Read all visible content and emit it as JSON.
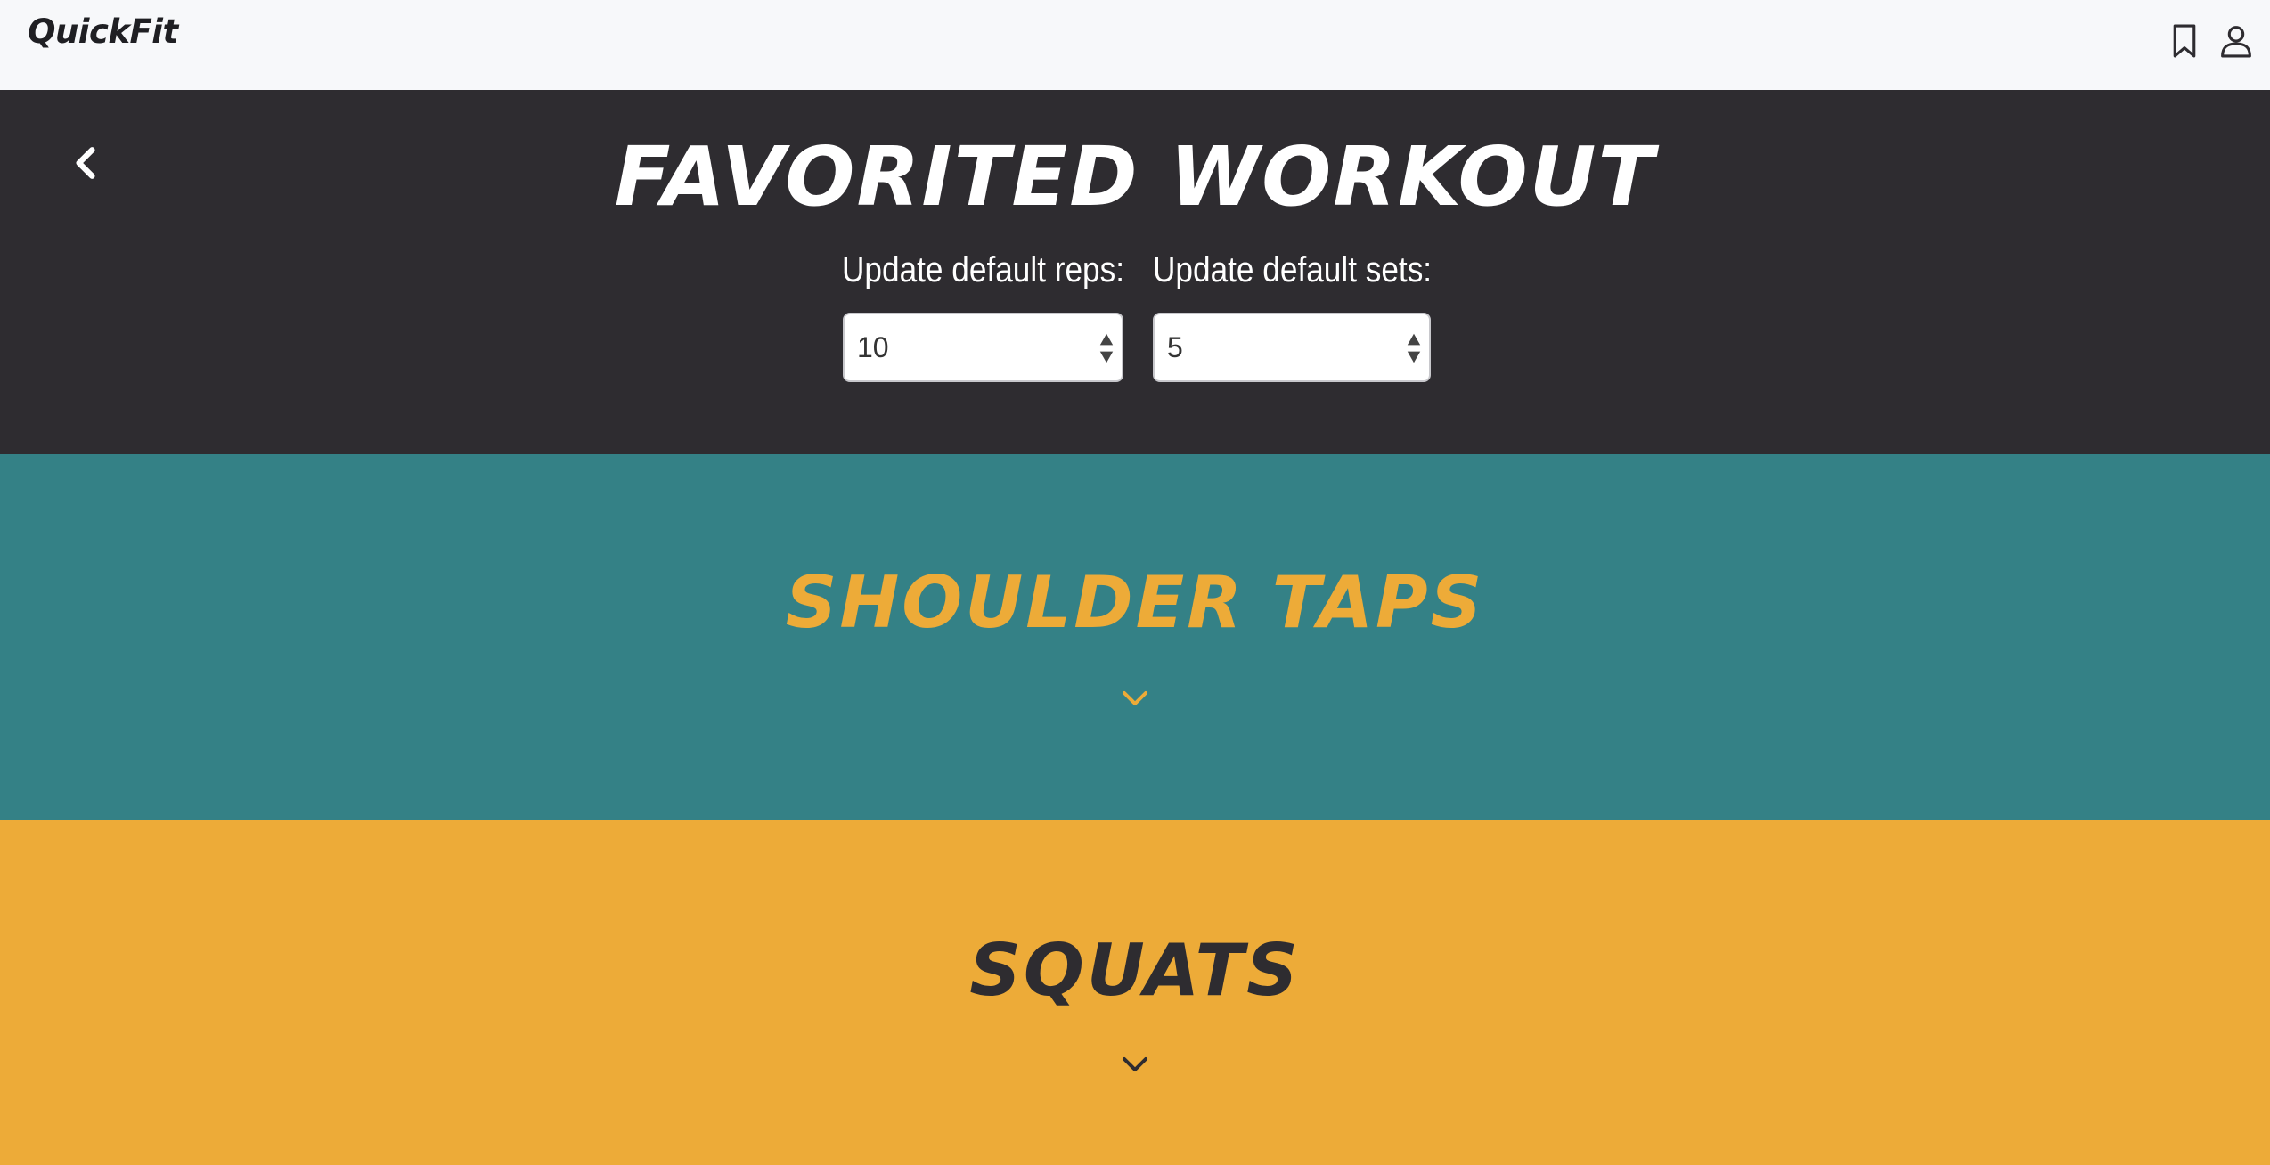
{
  "navbar": {
    "brand": "QuickFit",
    "icons": [
      "bookmark-icon",
      "user-icon"
    ]
  },
  "header": {
    "title": "FAVORITED WORKOUT",
    "reps_label": "Update default reps:",
    "reps_value": "10",
    "sets_label": "Update default sets:",
    "sets_value": "5"
  },
  "exercises": [
    {
      "name": "SHOULDER TAPS",
      "bg": "#348186",
      "color": "#edab38"
    },
    {
      "name": "SQUATS",
      "bg": "#edab38",
      "color": "#2e2c30"
    }
  ],
  "colors": {
    "dark": "#2e2c30",
    "teal": "#348186",
    "yellow": "#edab38",
    "nav_bg": "#f7f8fa"
  }
}
